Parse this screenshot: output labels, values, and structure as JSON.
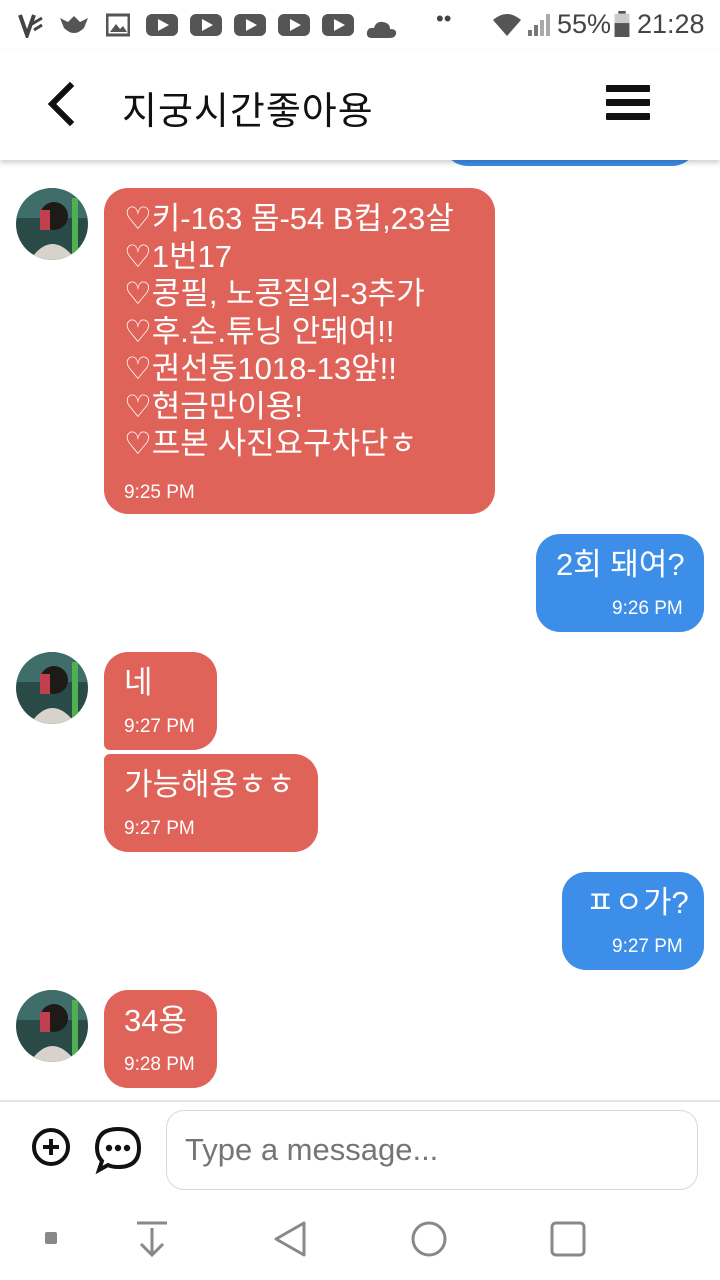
{
  "status_bar": {
    "icons": [
      "v-app-icon",
      "bird-app-icon",
      "image-icon",
      "youtube-icon",
      "youtube-icon",
      "youtube-icon",
      "youtube-icon",
      "youtube-icon",
      "cloud-icon",
      "dots-icon",
      "wifi-icon",
      "signal-icon",
      "battery-icon"
    ],
    "battery": "55%",
    "time": "21:28"
  },
  "header": {
    "title": "지궁시간좋아용",
    "back_icon": "chevron-left-icon",
    "menu_icon": "hamburger-menu-icon"
  },
  "messages": [
    {
      "side": "incoming",
      "text": "♡키-163 몸-54 B컵,23살\n♡1번17\n♡콩필, 노콩질외-3추가\n♡후.손.튜닝 안돼여!!\n♡권선동1018-13앞!!\n♡현금만이용!\n♡프본 사진요구차단ㅎ",
      "time": "9:25 PM"
    },
    {
      "side": "outgoing",
      "text": "2회 돼여?",
      "time": "9:26 PM"
    },
    {
      "side": "incoming",
      "text": "네",
      "time": "9:27 PM"
    },
    {
      "side": "incoming",
      "text": "가능해용ㅎㅎ",
      "time": "9:27 PM"
    },
    {
      "side": "outgoing",
      "text": "ㅍㅇ가?",
      "time": "9:27 PM"
    },
    {
      "side": "incoming",
      "text": "34용",
      "time": "9:28 PM"
    }
  ],
  "composer": {
    "placeholder": "Type a message...",
    "add_icon": "plus-circle-icon",
    "emoji_icon": "chat-bubble-icon"
  },
  "nav_bar": {
    "icons": [
      "small-square-icon",
      "download-icon",
      "back-triangle-icon",
      "home-circle-icon",
      "recents-square-icon"
    ]
  },
  "colors": {
    "incoming_bubble": "#e0635a",
    "outgoing_bubble": "#3d8ee8",
    "text_on_bubble": "#ffffff"
  }
}
